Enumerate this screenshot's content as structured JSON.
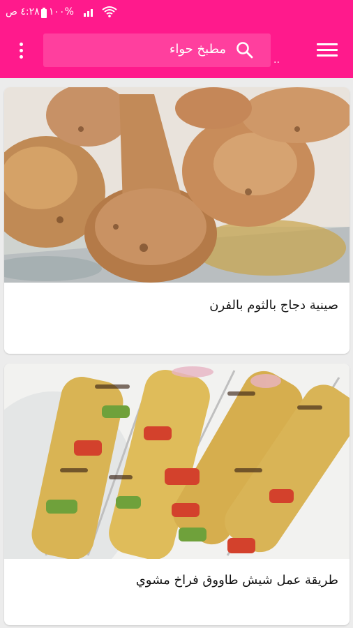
{
  "status_bar": {
    "time": "٤:٢٨ ص",
    "battery": "١٠٠%"
  },
  "search": {
    "value": "مطبخ حواء",
    "placeholder": ""
  },
  "header": {
    "dots": ".."
  },
  "recipes": [
    {
      "title": "صينية دجاج بالثوم بالفرن",
      "image": "baked-chicken-drumsticks-photo"
    },
    {
      "title": "طريقة عمل شيش طاووق فراخ مشوي",
      "image": "chicken-shish-tawook-skewers-photo"
    }
  ],
  "colors": {
    "appbar": "#ff1a8c",
    "search_bg": "#ff3f9e",
    "page_bg": "#ececec"
  }
}
